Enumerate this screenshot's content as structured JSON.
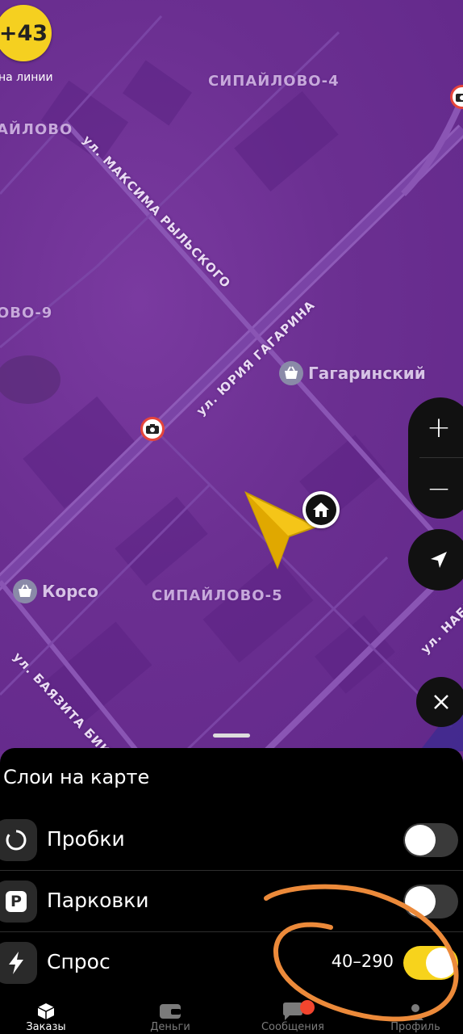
{
  "map": {
    "districts": [
      "СИПАЙЛОВО-4",
      "АЙЛОВО",
      "ОВО-9",
      "СИПАЙЛОВО-5"
    ],
    "streets": [
      "ул. МАКСИМА РЫЛЬСКОГО",
      "ул. ЮРИЯ ГАГАРИНА",
      "ул. БАЯЗИТА БИКБАЯ",
      "ул. НАБЕР"
    ],
    "pois": [
      "Гагаринский",
      "Корсо"
    ],
    "earnings_badge": "+43",
    "online_label": "на линии",
    "controls": {
      "zoom_in": "+",
      "zoom_out": "−"
    }
  },
  "sheet": {
    "title": "Слои на карте",
    "layers": [
      {
        "label": "Пробки",
        "icon": "traffic-circle-icon",
        "enabled": false
      },
      {
        "label": "Парковки",
        "icon": "parking-p-icon",
        "enabled": false
      },
      {
        "label": "Спрос",
        "icon": "lightning-icon",
        "enabled": true,
        "range": "40–290"
      }
    ]
  },
  "nav": {
    "items": [
      {
        "label": "Заказы",
        "icon": "orders-cube-icon",
        "active": true
      },
      {
        "label": "Деньги",
        "icon": "wallet-icon",
        "active": false
      },
      {
        "label": "Сообщения",
        "icon": "chat-bubble-icon",
        "active": false,
        "badge": true
      },
      {
        "label": "Профиль",
        "icon": "profile-icon",
        "active": false
      }
    ]
  },
  "colors": {
    "accent_yellow": "#f7d31c",
    "map_purple": "#6b2f91",
    "annotation_orange": "#ec8a3a"
  }
}
